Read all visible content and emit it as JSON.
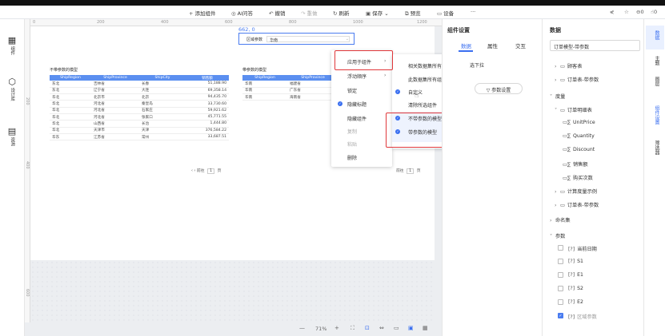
{
  "toolbar": {
    "add_component": "添加组件",
    "ai_ask": "AI问答",
    "undo": "撤销",
    "redo": "重做",
    "refresh": "刷新",
    "save": "保存",
    "preview": "预览",
    "device": "设备",
    "more": "···"
  },
  "left_nav": [
    {
      "label": "组件",
      "icon": "component-icon"
    },
    {
      "label": "设计库",
      "icon": "design-library-icon"
    },
    {
      "label": "资源",
      "icon": "resource-icon"
    }
  ],
  "ruler": {
    "h_ticks": [
      "0",
      "200",
      "400",
      "600",
      "800",
      "1000",
      "1200"
    ],
    "v_ticks": [
      "200",
      "400",
      "600"
    ]
  },
  "canvas": {
    "coord_readout": "662, 0",
    "param_component": {
      "label": "区域参数",
      "value": "华南"
    },
    "table_left": {
      "title": "不带参数的模型",
      "columns": [
        "ShipRegion",
        "ShipProvince",
        "ShipCity",
        "销售额"
      ],
      "rows": [
        [
          "东北",
          "吉林省",
          "长春",
          "51,188.90"
        ],
        [
          "东北",
          "辽宁省",
          "大连",
          "69,358.14"
        ],
        [
          "华北",
          "北京市",
          "北京",
          "94,435.70"
        ],
        [
          "华北",
          "河北省",
          "秦皇岛",
          "33,730.60"
        ],
        [
          "华北",
          "河北省",
          "石家庄",
          "59,921.62"
        ],
        [
          "华北",
          "河北省",
          "张家口",
          "45,771.55"
        ],
        [
          "华北",
          "山西省",
          "长治",
          "1,444.80"
        ],
        [
          "华北",
          "天津市",
          "天津",
          "376,584.22"
        ],
        [
          "华东",
          "江苏省",
          "常州",
          "33,687.51"
        ]
      ],
      "pager": {
        "prev": "前往",
        "page": "1",
        "unit": "页"
      }
    },
    "table_right": {
      "title": "带参数的模型",
      "columns": [
        "ShipRegion",
        "ShipProvince"
      ],
      "rows": [
        [
          "华南",
          "福建省"
        ],
        [
          "华南",
          "广东省"
        ],
        [
          "华南",
          "海南省"
        ]
      ],
      "pager": {
        "prev": "前往",
        "page": "1",
        "unit": "页"
      }
    }
  },
  "context_menu": {
    "items": [
      {
        "label": "应用于组件",
        "submenu": true,
        "disabled": false,
        "checked": false
      },
      {
        "label": "浮动顺序",
        "submenu": true,
        "disabled": false,
        "checked": false
      },
      {
        "label": "锁定",
        "submenu": false,
        "disabled": false,
        "checked": false
      },
      {
        "label": "隐藏标题",
        "submenu": false,
        "disabled": false,
        "checked": true
      },
      {
        "label": "隐藏组件",
        "submenu": false,
        "disabled": false,
        "checked": false
      },
      {
        "label": "复制",
        "submenu": false,
        "disabled": true,
        "checked": false
      },
      {
        "label": "粘贴",
        "submenu": false,
        "disabled": true,
        "checked": false
      },
      {
        "label": "删除",
        "submenu": false,
        "disabled": false,
        "checked": false
      }
    ],
    "submenu": [
      {
        "label": "相关数据集所有...",
        "checked": false
      },
      {
        "label": "此数据集所有组件",
        "checked": false
      },
      {
        "label": "自定义",
        "checked": true
      },
      {
        "label": "清除所选组件",
        "checked": false
      },
      {
        "label": "不带参数的模型",
        "checked": true
      },
      {
        "label": "带参数的模型",
        "checked": true
      }
    ]
  },
  "props_panel": {
    "title": "组件设置",
    "tabs": [
      "数据",
      "属性",
      "交互"
    ],
    "select_placeholder": "选下拉",
    "param_button": "参数设置"
  },
  "data_panel": {
    "title": "数据",
    "model_select": "订单模型-带参数",
    "tree": [
      {
        "label": "顾客表",
        "type": "folder",
        "expanded": false,
        "indent": 0
      },
      {
        "label": "订单表-带参数",
        "type": "folder",
        "expanded": false,
        "indent": 0
      },
      {
        "label": "度量",
        "type": "section",
        "expanded": true,
        "indent": 0
      },
      {
        "label": "订单明细表",
        "type": "folder",
        "expanded": true,
        "indent": 0
      },
      {
        "label": "UnitPrice",
        "type": "measure",
        "indent": 1
      },
      {
        "label": "Quantity",
        "type": "measure",
        "indent": 1
      },
      {
        "label": "Discount",
        "type": "measure",
        "indent": 1
      },
      {
        "label": "销售额",
        "type": "measure",
        "indent": 1
      },
      {
        "label": "购买次数",
        "type": "measure",
        "indent": 1
      },
      {
        "label": "计算度量示例",
        "type": "folder",
        "expanded": false,
        "indent": 0
      },
      {
        "label": "订单表-带参数",
        "type": "folder",
        "expanded": false,
        "indent": 0
      },
      {
        "label": "命名集",
        "type": "section",
        "expanded": false,
        "indent": 0
      },
      {
        "label": "参数",
        "type": "section",
        "expanded": true,
        "indent": 0
      }
    ],
    "params": [
      {
        "label": "当前日期",
        "checked": false
      },
      {
        "label": "S1",
        "checked": false
      },
      {
        "label": "E1",
        "checked": false
      },
      {
        "label": "S2",
        "checked": false
      },
      {
        "label": "E2",
        "checked": false
      },
      {
        "label": "区域参数",
        "checked": true
      }
    ]
  },
  "right_rail": [
    "数据",
    "主题",
    "图层",
    "组件设置",
    "筛选器"
  ],
  "zoom": {
    "level": "71%"
  }
}
